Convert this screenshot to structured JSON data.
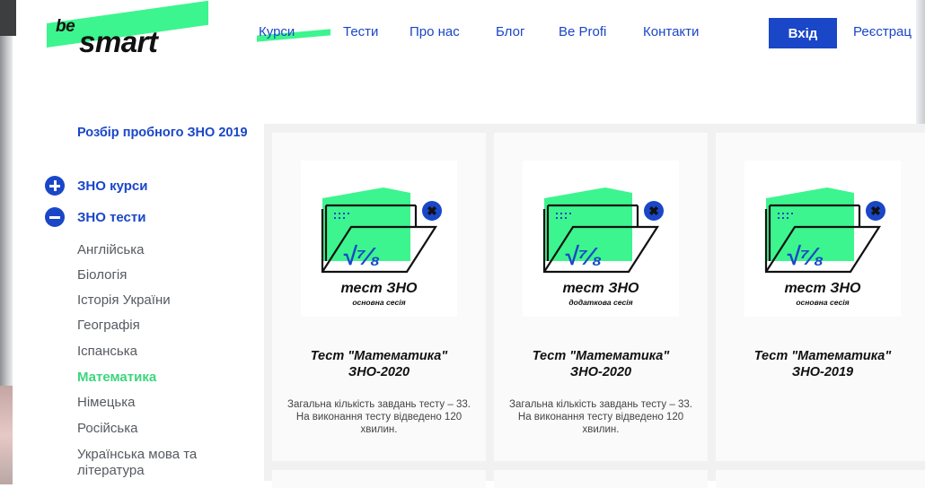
{
  "logo": {
    "prefix": "be",
    "main": "smart"
  },
  "nav": {
    "items": [
      "Курси",
      "Тести",
      "Про нас",
      "Блог",
      "Be Profi",
      "Контакти"
    ],
    "active": "Курси"
  },
  "auth": {
    "login": "Вхід",
    "register": "Реєстрац"
  },
  "sidebar": {
    "top_link": "Розбір пробного ЗНО 2019",
    "groups": [
      {
        "label": "ЗНО курси",
        "state": "collapsed"
      },
      {
        "label": "ЗНО тести",
        "state": "expanded"
      }
    ],
    "subjects": [
      "Англійська",
      "Біологія",
      "Історія України",
      "Географія",
      "Іспанська",
      "Математика",
      "Німецька",
      "Російська",
      "Українська мова та література"
    ],
    "active_subject": "Математика"
  },
  "cards": [
    {
      "thumb_title": "тест ЗНО",
      "thumb_subtitle": "основна сесія",
      "title": "Тест \"Математика\" ЗНО-2020",
      "description": "Загальна кількість завдань тесту – 33. На виконання тесту відведено 120 хвилин."
    },
    {
      "thumb_title": "тест ЗНО",
      "thumb_subtitle": "додаткова сесія",
      "title": "Тест \"Математика\" ЗНО-2020",
      "description": "Загальна кількість завдань тесту – 33. На виконання тесту відведено 120 хвилин."
    },
    {
      "thumb_title": "тест ЗНО",
      "thumb_subtitle": "основна сесія",
      "title": "Тест \"Математика\" ЗНО-2019",
      "description": ""
    }
  ],
  "colors": {
    "accent_blue": "#1a46c8",
    "accent_green": "#3cf58e",
    "active_subject": "#3cd67d"
  }
}
